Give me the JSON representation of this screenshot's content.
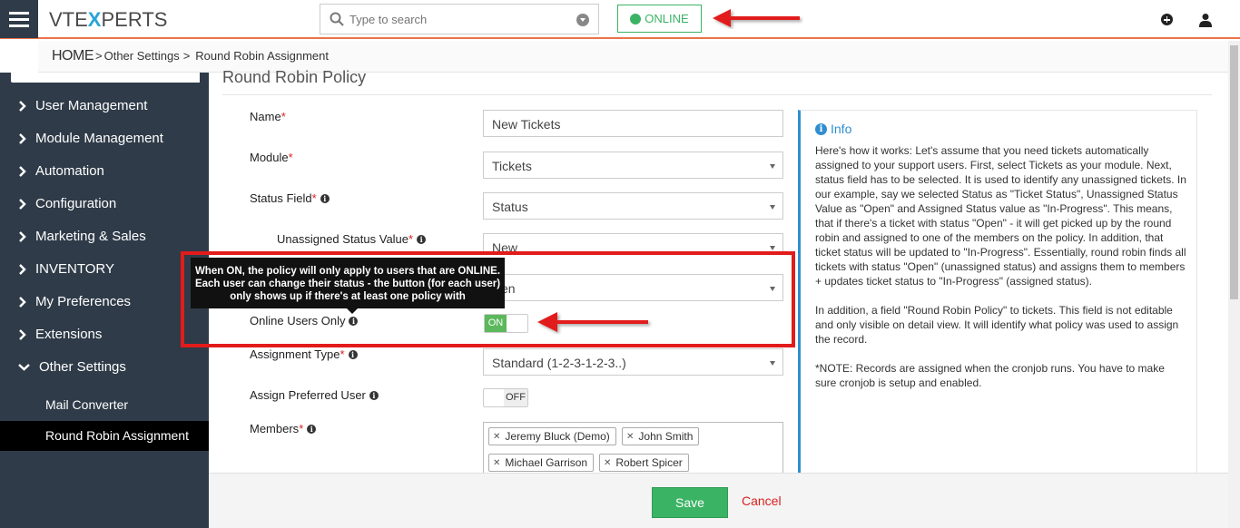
{
  "header": {
    "logo_left": "VTE",
    "logo_x": "X",
    "logo_right": "PERTS",
    "search_placeholder": "Type to search",
    "online_label": "ONLINE"
  },
  "breadcrumb": {
    "home": "HOME",
    "sep": ">",
    "item1": "Other Settings",
    "item2": "Round Robin Assignment"
  },
  "sidebar": {
    "items": [
      {
        "label": "User Management"
      },
      {
        "label": "Module Management"
      },
      {
        "label": "Automation"
      },
      {
        "label": "Configuration"
      },
      {
        "label": "Marketing & Sales"
      },
      {
        "label": "INVENTORY"
      },
      {
        "label": "My Preferences"
      },
      {
        "label": "Extensions"
      },
      {
        "label": "Other Settings"
      }
    ],
    "sub_items": [
      {
        "label": "Mail Converter"
      },
      {
        "label": "Round Robin Assignment"
      }
    ]
  },
  "form": {
    "section_title": "Round Robin Policy",
    "name_label": "Name",
    "name_value": "New Tickets",
    "module_label": "Module",
    "module_value": "Tickets",
    "status_field_label": "Status Field",
    "status_field_value": "Status",
    "unassigned_label": "Unassigned Status Value",
    "unassigned_value": "New",
    "assigned_value_partial": "en",
    "online_users_label": "Online Users Only",
    "online_toggle": "ON",
    "assignment_type_label": "Assignment Type",
    "assignment_type_value": "Standard (1-2-3-1-2-3..)",
    "assign_preferred_label": "Assign Preferred User",
    "assign_preferred_toggle": "OFF",
    "members_label": "Members",
    "members": [
      "Jeremy Bluck (Demo)",
      "John Smith",
      "Michael Garrison",
      "Robert Spicer"
    ],
    "required_mark": "*",
    "info_glyph": "i"
  },
  "tooltip": {
    "line1": "When ON, the policy will only apply to users that are ONLINE.",
    "line2": "Each user can change their status - the button (for each user)",
    "line3": "only shows up if there's at least one policy with"
  },
  "info": {
    "title": "Info",
    "p1": "Here's how it works: Let's assume that you need tickets automatically assigned to your support users. First, select Tickets as your module. Next, status field has to be selected. It is used to identify any unassigned tickets. In our example, say we selected Status as \"Ticket Status\", Unassigned Status Value as \"Open\" and Assigned Status value as \"In-Progress\". This means, that if there's a ticket with status \"Open\" - it will get picked up by the round robin and assigned to one of the members on the policy. In addition, that ticket status will be updated to \"In-Progress\". Essentially, round robin finds all tickets with status \"Open\" (unassigned status) and assigns them to members + updates ticket status to \"In-Progress\" (assigned status).",
    "p2": "In addition, a field \"Round Robin Policy\" to tickets. This field is not editable and only visible on detail view. It will identify what policy was used to assign the record.",
    "p3": "*NOTE: Records are assigned when the cronjob runs. You have to make sure cronjob is setup and enabled."
  },
  "footer": {
    "save_label": "Save",
    "cancel_label": "Cancel"
  },
  "colors": {
    "accent_green": "#3bb364",
    "sidebar_bg": "#2f3b48",
    "annotation_red": "#e21b1b",
    "info_blue": "#2f8ecf"
  }
}
